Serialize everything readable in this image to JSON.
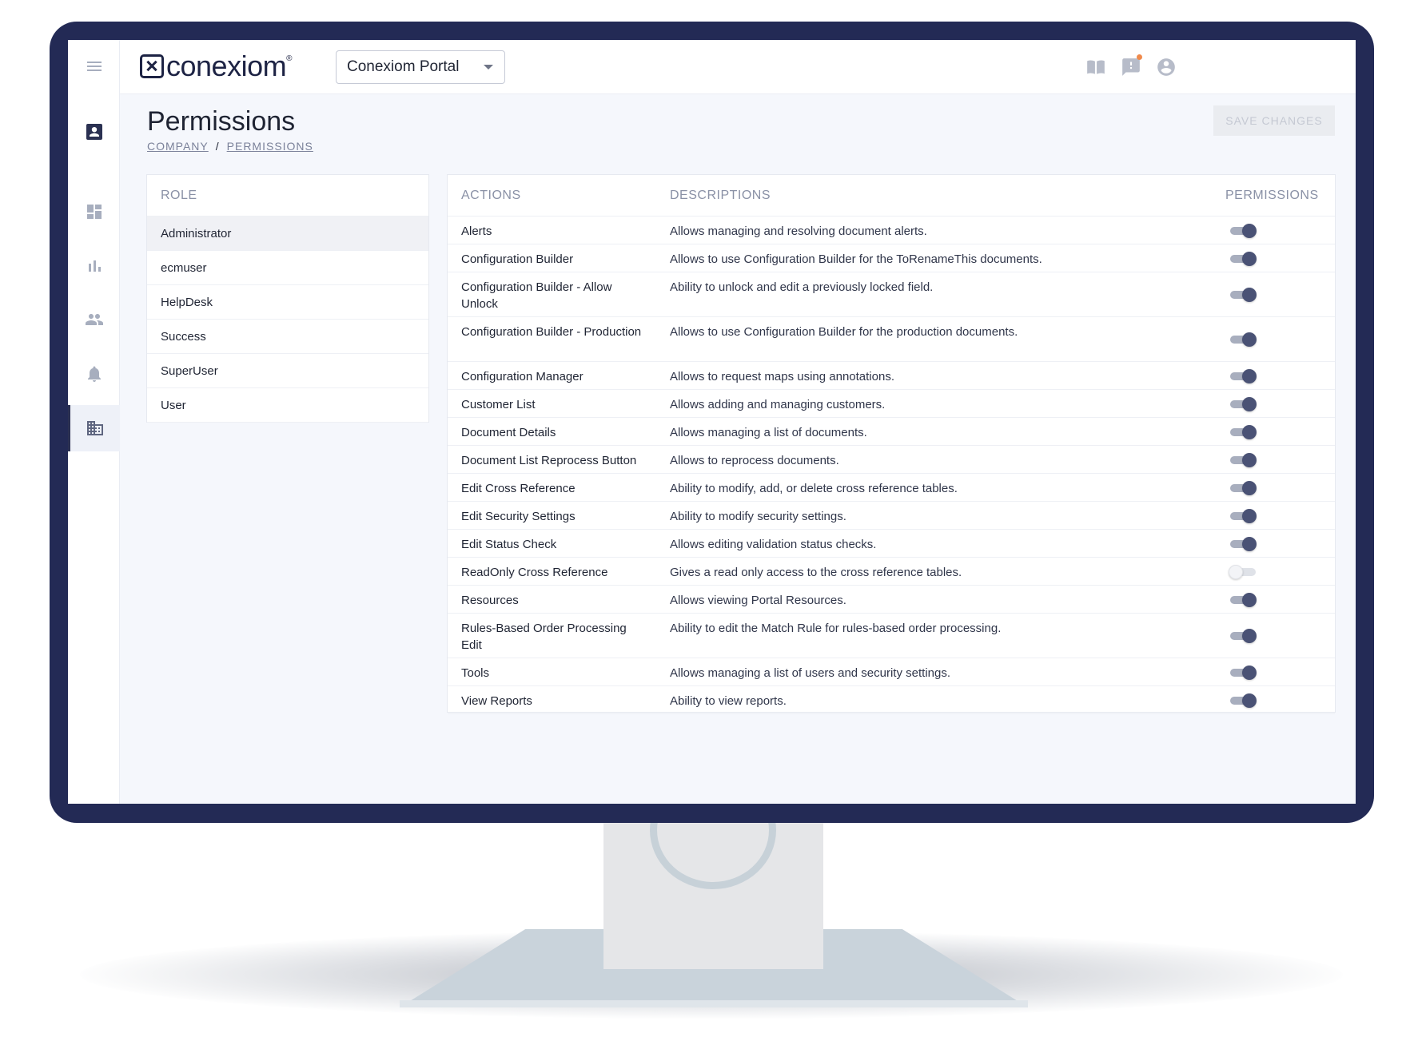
{
  "app": {
    "logo_text": "conexiom",
    "logo_reg": "®",
    "portal_select_value": "Conexiom Portal"
  },
  "header": {
    "title": "Permissions",
    "breadcrumb": [
      "COMPANY",
      "PERMISSIONS"
    ],
    "breadcrumb_sep": "/",
    "save_label": "SAVE CHANGES"
  },
  "roles": {
    "header": "ROLE",
    "items": [
      "Administrator",
      "ecmuser",
      "HelpDesk",
      "Success",
      "SuperUser",
      "User"
    ]
  },
  "permissions": {
    "headers": {
      "actions": "ACTIONS",
      "descriptions": "DESCRIPTIONS",
      "permissions": "PERMISSIONS"
    },
    "rows": [
      {
        "action": "Alerts",
        "description": "Allows managing and resolving document alerts.",
        "enabled": true
      },
      {
        "action": "Configuration Builder",
        "description": "Allows to use Configuration Builder for the ToRenameThis documents.",
        "enabled": true
      },
      {
        "action": "Configuration Builder - Allow Unlock",
        "description": "Ability to unlock and edit a previously locked field.",
        "enabled": true
      },
      {
        "action": "Configuration Builder - Production",
        "description": "Allows to use Configuration Builder for the production documents.",
        "enabled": true
      },
      {
        "action": "Configuration Manager",
        "description": "Allows to request maps using annotations.",
        "enabled": true
      },
      {
        "action": "Customer List",
        "description": "Allows adding and managing customers.",
        "enabled": true
      },
      {
        "action": "Document Details",
        "description": "Allows managing a list of documents.",
        "enabled": true
      },
      {
        "action": "Document List Reprocess Button",
        "description": "Allows to reprocess documents.",
        "enabled": true
      },
      {
        "action": "Edit Cross Reference",
        "description": "Ability to modify, add, or delete cross reference tables.",
        "enabled": true
      },
      {
        "action": "Edit Security Settings",
        "description": "Ability to modify security settings.",
        "enabled": true
      },
      {
        "action": "Edit Status Check",
        "description": "Allows editing validation status checks.",
        "enabled": true
      },
      {
        "action": "ReadOnly Cross Reference",
        "description": "Gives a read only access to the cross reference tables.",
        "enabled": false
      },
      {
        "action": "Resources",
        "description": "Allows viewing Portal Resources.",
        "enabled": true
      },
      {
        "action": "Rules-Based Order Processing Edit",
        "description": "Ability to edit the Match Rule for rules-based order processing.",
        "enabled": true
      },
      {
        "action": "Tools",
        "description": "Allows managing a list of users and security settings.",
        "enabled": true
      },
      {
        "action": "View Reports",
        "description": "Ability to view reports.",
        "enabled": true
      }
    ]
  },
  "icons": {
    "sidebar": [
      "menu-icon",
      "contact-card-icon",
      "dashboard-icon",
      "bar-chart-icon",
      "people-icon",
      "bell-icon",
      "company-building-icon"
    ],
    "topbar": [
      "book-icon",
      "feedback-icon",
      "account-circle-icon"
    ]
  },
  "colors": {
    "frame": "#232a55",
    "accent": "#4a5275",
    "notification": "#f08a4b"
  }
}
